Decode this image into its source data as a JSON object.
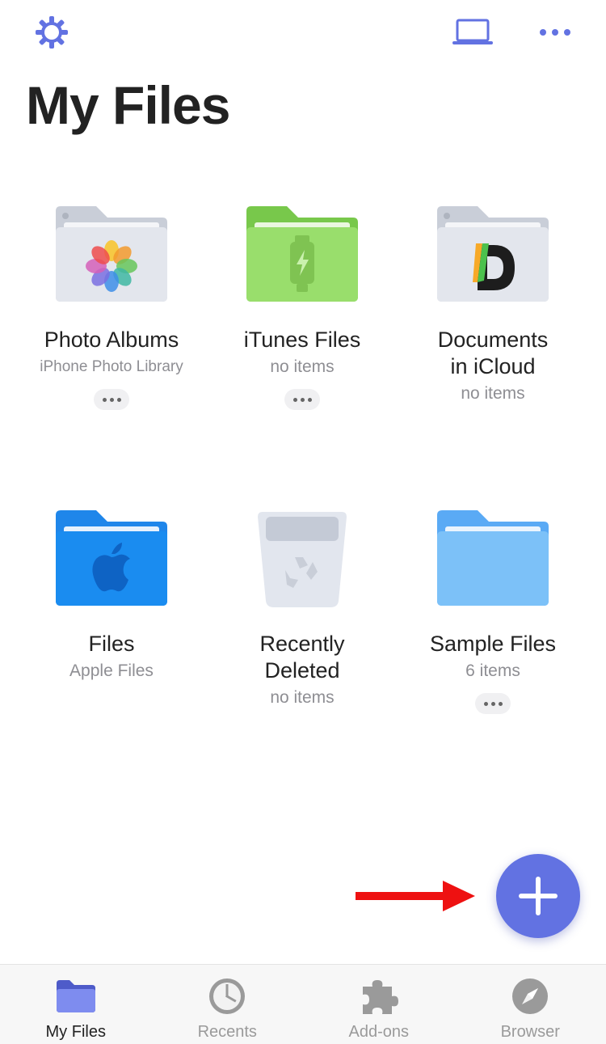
{
  "header": {
    "title": "My Files",
    "settings_icon": "gear-icon",
    "laptop_icon": "laptop-icon",
    "more_icon": "ellipsis-icon"
  },
  "colors": {
    "accent": "#6272e2",
    "itunes_green": "#8fd35f",
    "files_blue": "#1a8cf0",
    "sample_blue": "#7cc1f8"
  },
  "items": [
    {
      "name": "Photo Albums",
      "subtitle": "iPhone Photo Library",
      "icon": "photos-folder-icon",
      "has_menu": true
    },
    {
      "name": "iTunes Files",
      "subtitle": "no items",
      "icon": "itunes-folder-icon",
      "has_menu": true
    },
    {
      "name": "Documents\nin iCloud",
      "subtitle": "no items",
      "icon": "icloud-folder-icon",
      "has_menu": false
    },
    {
      "name": "Files",
      "subtitle": "Apple Files",
      "icon": "apple-files-folder-icon",
      "has_menu": false
    },
    {
      "name": "Recently\nDeleted",
      "subtitle": "no items",
      "icon": "trash-icon",
      "has_menu": false
    },
    {
      "name": "Sample Files",
      "subtitle": "6 items",
      "icon": "folder-icon",
      "has_menu": true
    }
  ],
  "fab": {
    "icon": "plus-icon"
  },
  "tabs": [
    {
      "label": "My Files",
      "icon": "folder-icon",
      "active": true
    },
    {
      "label": "Recents",
      "icon": "clock-icon",
      "active": false
    },
    {
      "label": "Add-ons",
      "icon": "puzzle-icon",
      "active": false
    },
    {
      "label": "Browser",
      "icon": "compass-icon",
      "active": false
    }
  ]
}
